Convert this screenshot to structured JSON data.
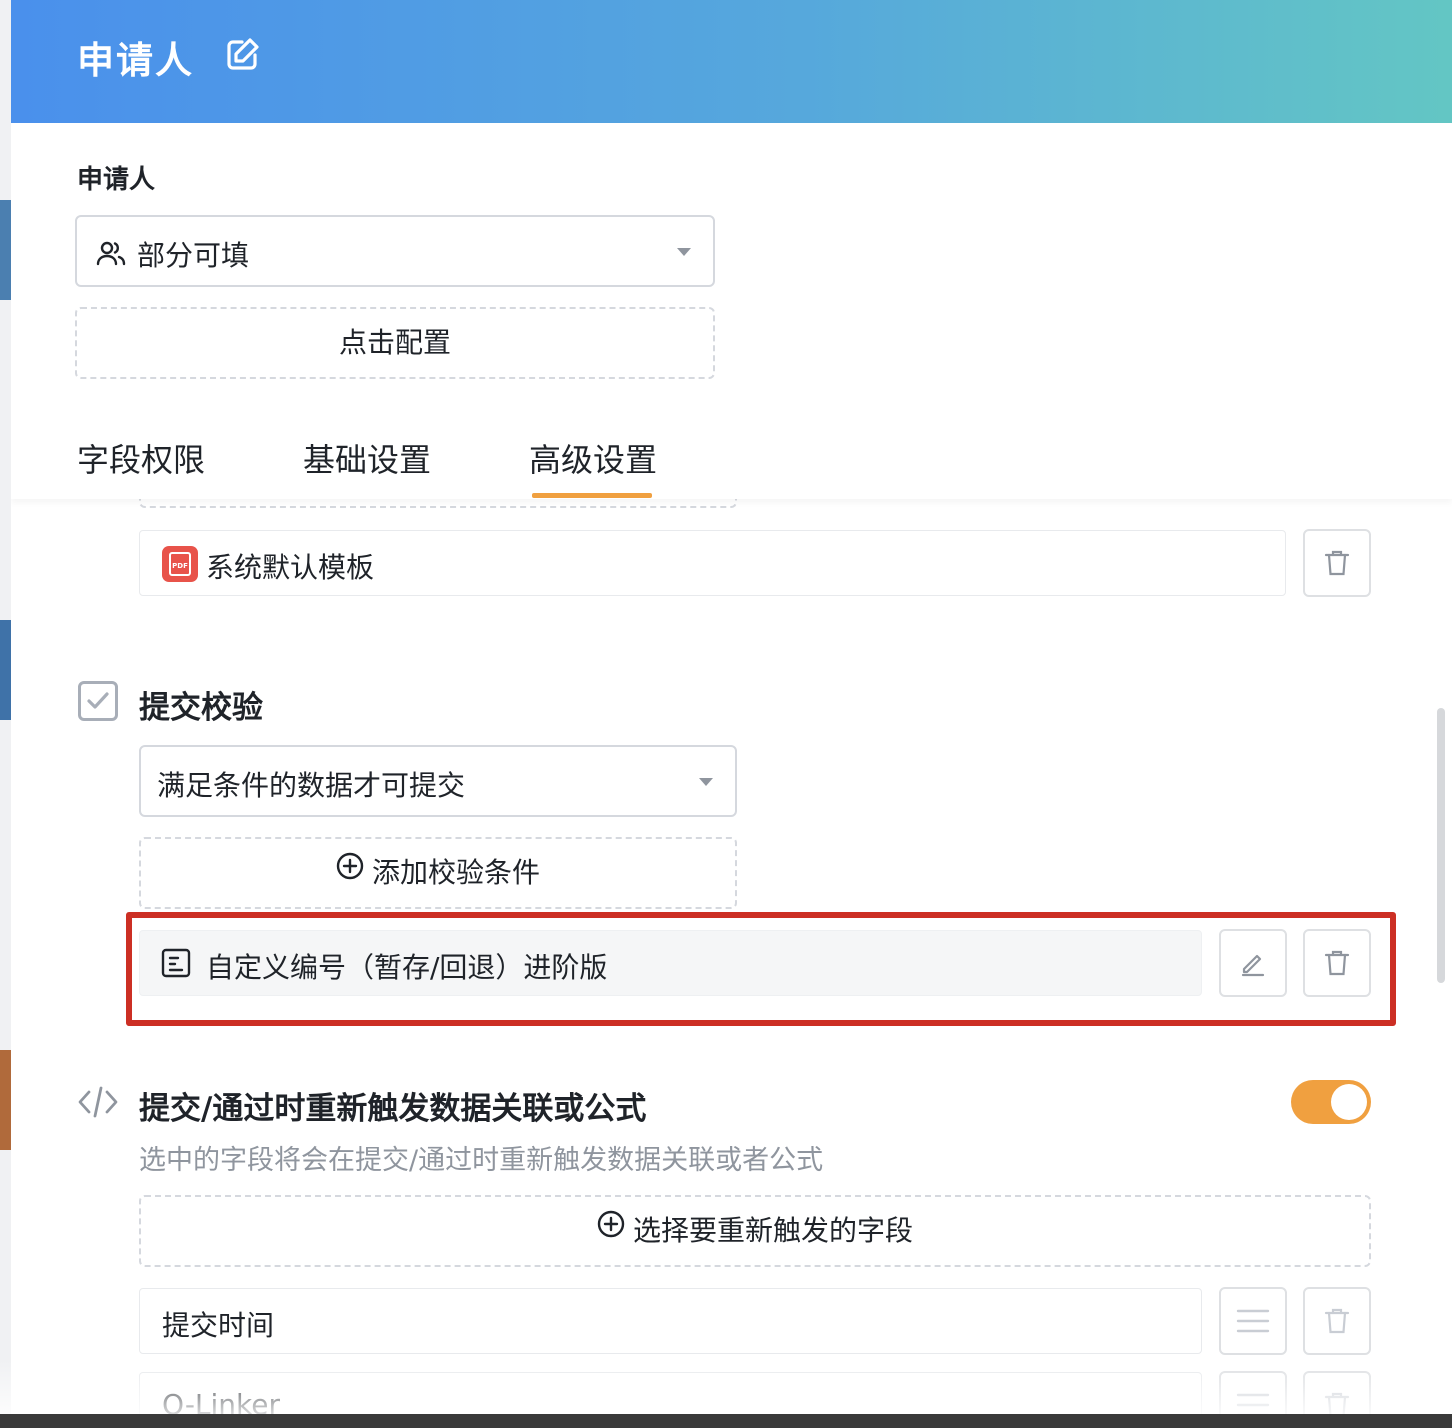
{
  "header": {
    "title": "申请人"
  },
  "applicant": {
    "label": "申请人",
    "permission_select": "部分可填",
    "configure_button": "点击配置"
  },
  "tabs": [
    {
      "label": "字段权限",
      "active": false
    },
    {
      "label": "基础设置",
      "active": false
    },
    {
      "label": "高级设置",
      "active": true
    }
  ],
  "template_row": {
    "badge": "PDF",
    "label": "系统默认模板"
  },
  "submit_validation": {
    "title": "提交校验",
    "checked": true,
    "condition_select": "满足条件的数据才可提交",
    "add_condition_button": "添加校验条件",
    "conditions": [
      {
        "label": "自定义编号（暂存/回退）进阶版"
      }
    ]
  },
  "retrigger": {
    "title": "提交/通过时重新触发数据关联或公式",
    "description": "选中的字段将会在提交/通过时重新触发数据关联或者公式",
    "enabled": true,
    "select_fields_button": "选择要重新触发的字段",
    "fields": [
      {
        "label": "提交时间"
      },
      {
        "label": "Q-Linker"
      }
    ]
  },
  "colors": {
    "accent": "#f0a040",
    "highlight_border": "#cc2f24",
    "header_gradient_start": "#4a90ec",
    "header_gradient_end": "#63c6c4"
  }
}
